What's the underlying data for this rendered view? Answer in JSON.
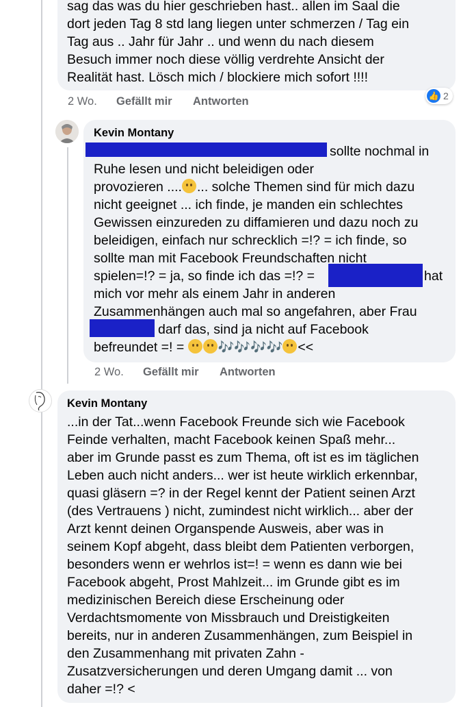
{
  "comment1": {
    "lines": [
      "sag das was du hier geschrieben hast.. allen im Saal die",
      "dort jeden Tag 8 std lang liegen unter schmerzen / Tag ein",
      "Tag aus .. Jahr für Jahr .. und wenn du nach diesem",
      "Besuch immer noch diese völlig verdrehte Ansicht der",
      "Realität hast. Lösch mich / blockiere mich sofort !!!!"
    ],
    "age": "2 Wo.",
    "like_label": "Gefällt mir",
    "reply_label": "Antworten",
    "reaction_count": "2"
  },
  "comment2": {
    "author": "Kevin Montany",
    "line1_suffix": "sollte nochmal in",
    "lines_mid": [
      "Ruhe lesen und nicht beleidigen oder",
      "provozieren ....",
      "nicht geeignet ... ich finde, je manden ein schlechtes",
      "Gewissen einzureden zu diffamieren und dazu noch zu",
      "beleidigen, einfach nur schrecklich =!? = ich finde, so",
      "sollte man mit  Facebook Freundschaften nicht"
    ],
    "line3_suffix": "... solche Themen sind für mich dazu",
    "line9_prefix": "spielen=!? = ja, so finde ich das =!? =",
    "line9_suffix": "hat",
    "line10": "mich vor mehr als einem Jahr in anderen",
    "line11": "Zusammenhängen auch mal so angefahren, aber Frau",
    "line12_suffix": "darf das, sind ja nicht auf Facebook",
    "line13_prefix": "befreundet =! =",
    "line13_suffix": "<<",
    "age": "2 Wo.",
    "like_label": "Gefällt mir",
    "reply_label": "Antworten"
  },
  "comment3": {
    "author": "Kevin Montany",
    "lines": [
      "...in der Tat...wenn Facebook Freunde sich wie Facebook",
      "Feinde verhalten, macht Facebook keinen Spaß mehr...",
      "aber im Grunde passt es zum Thema, oft ist es im täglichen",
      "Leben auch nicht anders... wer ist heute wirklich erkennbar,",
      "quasi gläsern =? in der Regel kennt der Patient seinen Arzt",
      "(des Vertrauens ) nicht, zumindest nicht wirklich... aber der",
      "Arzt kennt deinen Organspende Ausweis, aber was in",
      "seinem Kopf abgeht, dass bleibt dem Patienten verborgen,",
      "besonders wenn er wehrlos ist=! = wenn es dann wie bei",
      "Facebook abgeht, Prost Mahlzeit... im Grunde gibt es im",
      "medizinischen Bereich diese Erscheinung oder",
      "Verdachtsmomente von Missbrauch und Dreistigkeiten",
      "bereits, nur in anderen Zusammenhängen, zum Beispiel in",
      "den Zusammenhang mit privaten Zahn -",
      "Zusatzversicherungen und deren Umgang damit ... von",
      "daher =!? <"
    ]
  },
  "colors": {
    "bubble": "#f0f2f5",
    "redaction": "#1a21c7",
    "like_blue": "#1877f2",
    "muted": "#65676b"
  }
}
